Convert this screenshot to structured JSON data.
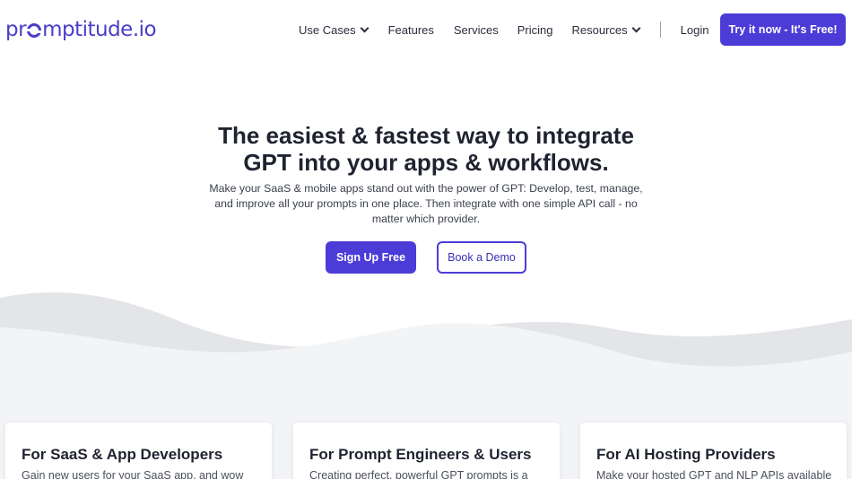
{
  "header": {
    "logo": {
      "prefix": "pr",
      "middle": "mptitude",
      "tld": ".io"
    },
    "nav": [
      {
        "label": "Use Cases",
        "dropdown": true
      },
      {
        "label": "Features",
        "dropdown": false
      },
      {
        "label": "Services",
        "dropdown": false
      },
      {
        "label": "Pricing",
        "dropdown": false
      },
      {
        "label": "Resources",
        "dropdown": true
      },
      {
        "label": "Login",
        "dropdown": false
      }
    ],
    "cta_label": "Try it now - It's Free!"
  },
  "hero": {
    "title_line1": "The easiest & fastest way to integrate",
    "title_line2": "GPT into your apps & workflows.",
    "subtitle": "Make your SaaS & mobile apps stand out with the power of GPT: Develop, test, manage, and improve all your prompts in one place. Then integrate with one simple API call - no matter which provider.",
    "signup_label": "Sign Up Free",
    "demo_label": "Book a Demo"
  },
  "cards": [
    {
      "title": "For SaaS & App Developers",
      "text": "Gain new users for your SaaS app, and wow"
    },
    {
      "title": "For Prompt Engineers & Users",
      "text": "Creating perfect, powerful GPT prompts is a"
    },
    {
      "title": "For AI Hosting Providers",
      "text": "Make your hosted GPT and NLP APIs available"
    }
  ],
  "colors": {
    "brand": "#4b3cd8",
    "text": "#1f2330",
    "wave": "#e4e5e8",
    "band": "#f3f4f6"
  },
  "icons": [
    "chevron-down-icon"
  ]
}
